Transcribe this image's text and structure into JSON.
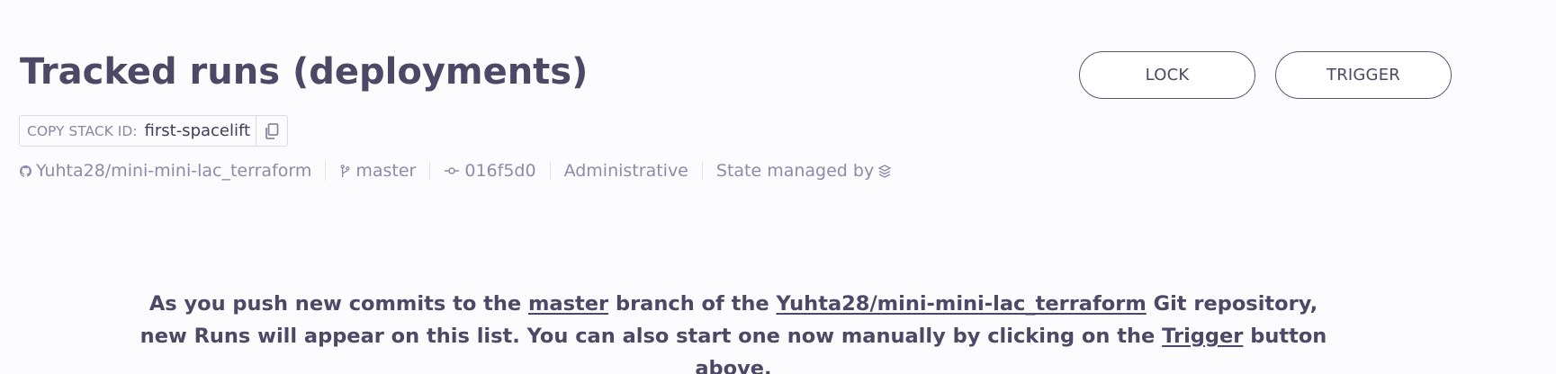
{
  "header": {
    "title": "Tracked runs (deployments)",
    "lock_label": "LOCK",
    "trigger_label": "TRIGGER"
  },
  "stack": {
    "copy_label": "COPY STACK ID:",
    "id": "first-spacelift"
  },
  "meta": {
    "repository": "Yuhta28/mini-mini-lac_terraform",
    "branch": "master",
    "commit": "016f5d0",
    "role": "Administrative",
    "state_label": "State managed by"
  },
  "empty_state": {
    "part1": "As you push new commits to the ",
    "branch_link": "master",
    "part2": " branch of the ",
    "repo_link": "Yuhta28/mini-mini-lac_terraform",
    "part3": " Git repository, new Runs will appear on this list. You can also start one now manually by clicking on the ",
    "trigger_link": "Trigger",
    "part4": " button above."
  },
  "icons": {
    "repository": "github-icon",
    "branch": "git-branch-icon",
    "commit": "git-commit-icon",
    "state_provider": "spacelift-logo-icon",
    "copy": "copy-icon"
  },
  "colors": {
    "background": "#fcfbfe",
    "text_primary": "#4b4966",
    "text_muted": "#8d8ba8",
    "border": "#dcdae8"
  }
}
